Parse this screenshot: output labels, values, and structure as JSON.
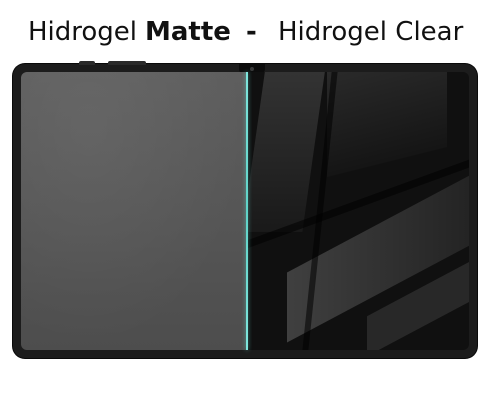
{
  "headline": {
    "matte_word": "Hidrogel",
    "matte_bold": "Matte",
    "separator": "-",
    "clear_label": "Hidrogel Clear"
  },
  "colors": {
    "matte_screen": "#585858",
    "clear_screen": "#101010",
    "bezel": "#1c1c1c",
    "divider": "#5fd3c8"
  }
}
